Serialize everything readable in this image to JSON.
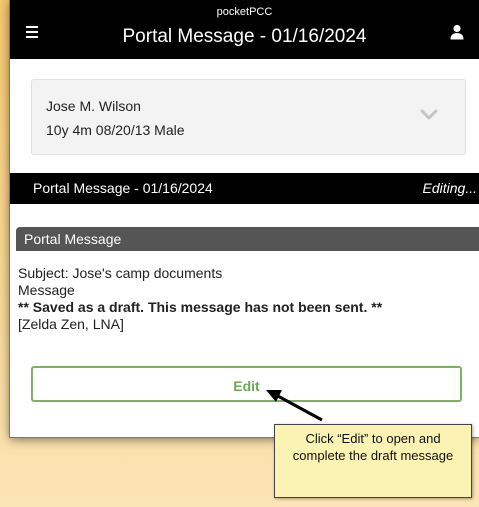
{
  "topbar": {
    "app_name": "pocketPCC",
    "title": "Portal Message - 01/16/2024",
    "menu_icon": "hamburger-menu-icon",
    "user_icon": "user-icon"
  },
  "patient": {
    "name": "Jose M. Wilson",
    "details": "10y 4m  08/20/13  Male",
    "expand_icon": "chevron-down-icon"
  },
  "section": {
    "title": "Portal Message - 01/16/2024",
    "status": "Editing..."
  },
  "message_panel": {
    "header": "Portal Message",
    "subject": "Subject: Jose's camp documents",
    "message_label": "Message",
    "draft_notice": "** Saved as a draft. This message has not been sent. **",
    "author": "[Zelda Zen, LNA]"
  },
  "actions": {
    "edit_label": "Edit"
  },
  "callout": {
    "text": "Click “Edit” to open and complete the draft message"
  },
  "colors": {
    "topbar_bg": "#000000",
    "panel_header_bg": "#555555",
    "edit_accent": "#7cb06a",
    "callout_bg": "#fbf3b4",
    "background_gradient_top": "#f6c86e"
  }
}
